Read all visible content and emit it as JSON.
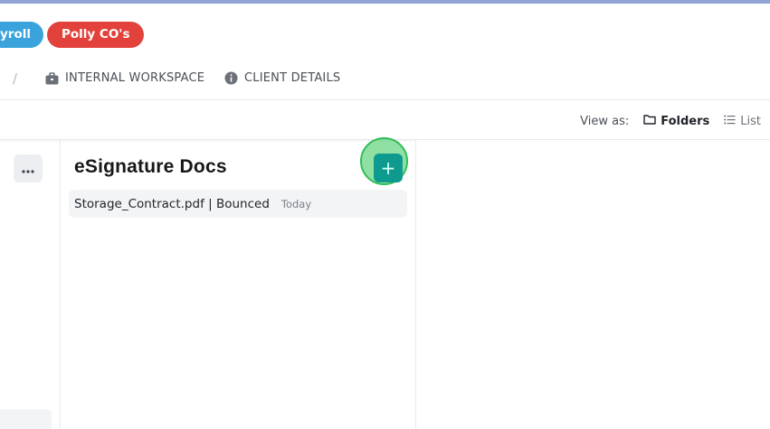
{
  "chips": {
    "payroll": "yroll",
    "polly": "Polly CO's"
  },
  "nav": {
    "separator": "/",
    "internal_workspace": "INTERNAL WORKSPACE",
    "client_details": "CLIENT DETAILS"
  },
  "view": {
    "label": "View as:",
    "folders": "Folders",
    "list": "List"
  },
  "panel": {
    "title": "eSignature Docs",
    "add_label": "+",
    "files": [
      {
        "name": "Storage_Contract.pdf | Bounced",
        "date": "Today"
      }
    ]
  },
  "colors": {
    "accent_bar": "#8fa3d6",
    "payroll_chip": "#3aa3dc",
    "polly_chip": "#e3413c",
    "add_button": "#0f9a90",
    "highlight_halo": "#2fbe56"
  },
  "icons": {
    "internal_workspace": "briefcase-icon",
    "client_details": "info-icon",
    "folders": "folder-icon",
    "list": "list-icon",
    "more": "more-horizontal-icon",
    "add": "plus-icon"
  }
}
